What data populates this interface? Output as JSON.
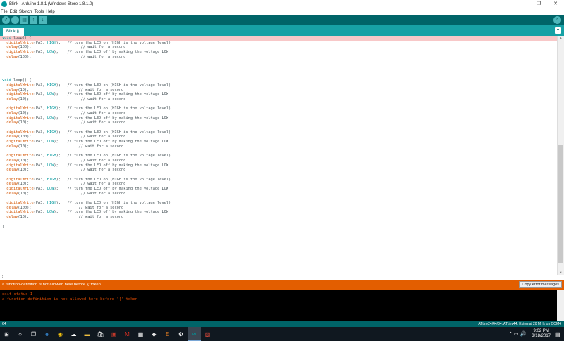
{
  "window": {
    "title": "Blink | Arduino 1.8.1 (Windows Store 1.8.1.0)",
    "controls": [
      "—",
      "❐",
      "✕"
    ]
  },
  "menu": [
    "File",
    "Edit",
    "Sketch",
    "Tools",
    "Help"
  ],
  "toolbar": {
    "verify_glyph": "✓",
    "upload_glyph": "→",
    "new_glyph": "▤",
    "open_glyph": "↑",
    "save_glyph": "↓",
    "serial_glyph": "⌕"
  },
  "tab": {
    "label": "Blink §",
    "menu_glyph": "▾"
  },
  "code": {
    "loop_a": {
      "header": "void loop() {",
      "lines": [
        {
          "fn": "digitalWrite",
          "args": "(PA3, ",
          "const": "HIGH",
          "tail": ");   // turn the LED on (HIGH is the voltage level)"
        },
        {
          "fn": "delay",
          "args": "(100);",
          "const": "",
          "tail": "                      // wait for a second"
        },
        {
          "fn": "digitalWrite",
          "args": "(PA3, ",
          "const": "LOW",
          "tail": ");    // turn the LED off by making the voltage LOW"
        },
        {
          "fn": "delay",
          "args": "(100);",
          "const": "",
          "tail": "                      // wait for a second"
        }
      ]
    },
    "loop_b_header": "void loop() {",
    "blocks": [
      [
        {
          "fn": "digitalWrite",
          "args": "(PA3, ",
          "const": "HIGH",
          "tail": ");   // turn the LED on (HIGH is the voltage level)"
        },
        {
          "fn": "delay",
          "args": "(10);",
          "const": "",
          "tail": "                      // wait for a second"
        },
        {
          "fn": "digitalWrite",
          "args": "(PA3, ",
          "const": "LOW",
          "tail": ");    // turn the LED off by making the voltage LOW"
        },
        {
          "fn": "delay",
          "args": "(10);",
          "const": "",
          "tail": "                       // wait for a second"
        }
      ],
      [
        {
          "fn": "digitalWrite",
          "args": "(PA3, ",
          "const": "HIGH",
          "tail": ");   // turn the LED on (HIGH is the voltage level)"
        },
        {
          "fn": "delay",
          "args": "(10);",
          "const": "",
          "tail": "                       // wait for a second"
        },
        {
          "fn": "digitalWrite",
          "args": "(PA3, ",
          "const": "LOW",
          "tail": ");    // turn the LED off by making the voltage LOW"
        },
        {
          "fn": "delay",
          "args": "(10);",
          "const": "",
          "tail": "                       // wait for a second"
        }
      ],
      [
        {
          "fn": "digitalWrite",
          "args": "(PA3, ",
          "const": "HIGH",
          "tail": ");   // turn the LED on (HIGH is the voltage level)"
        },
        {
          "fn": "delay",
          "args": "(100);",
          "const": "",
          "tail": "                      // wait for a second"
        },
        {
          "fn": "digitalWrite",
          "args": "(PA3, ",
          "const": "LOW",
          "tail": ");    // turn the LED off by making the voltage LOW"
        },
        {
          "fn": "delay",
          "args": "(10);",
          "const": "",
          "tail": "                      // wait for a second"
        }
      ],
      [
        {
          "fn": "digitalWrite",
          "args": "(PA3, ",
          "const": "HIGH",
          "tail": ");   // turn the LED on (HIGH is the voltage level)"
        },
        {
          "fn": "delay",
          "args": "(10);",
          "const": "",
          "tail": "                       // wait for a second"
        },
        {
          "fn": "digitalWrite",
          "args": "(PA3, ",
          "const": "LOW",
          "tail": ");    // turn the LED off by making the voltage LOW"
        },
        {
          "fn": "delay",
          "args": "(10);",
          "const": "",
          "tail": "                       // wait for a second"
        }
      ],
      [
        {
          "fn": "digitalWrite",
          "args": "(PA3, ",
          "const": "HIGH",
          "tail": ");   // turn the LED on (HIGH is the voltage level)"
        },
        {
          "fn": "delay",
          "args": "(10);",
          "const": "",
          "tail": "                       // wait for a second"
        },
        {
          "fn": "digitalWrite",
          "args": "(PA3, ",
          "const": "LOW",
          "tail": ");    // turn the LED off by making the voltage LOW"
        },
        {
          "fn": "delay",
          "args": "(10);",
          "const": "",
          "tail": "                       // wait for a second"
        }
      ],
      [
        {
          "fn": "digitalWrite",
          "args": "(PA3, ",
          "const": "HIGH",
          "tail": ");   // turn the LED on (HIGH is the voltage level)"
        },
        {
          "fn": "delay",
          "args": "(100);",
          "const": "",
          "tail": "                     // wait for a second"
        },
        {
          "fn": "digitalWrite",
          "args": "(PA3, ",
          "const": "LOW",
          "tail": ");    // turn the LED off by making the voltage LOW"
        },
        {
          "fn": "delay",
          "args": "(10);",
          "const": "",
          "tail": "                      // wait for a second"
        }
      ]
    ],
    "closing": "}"
  },
  "message": {
    "text": "a function-definition is not allowed here before '{' token",
    "copy_label": "Copy error messages"
  },
  "console": [
    "exit status 1",
    "a function-definition is not allowed here before '{' token"
  ],
  "status": {
    "line": "64",
    "board": "ATtiny24/44/84, ATtiny44, External 20 MHz on COM4"
  },
  "taskbar": {
    "items": [
      {
        "name": "windows-start-icon",
        "glyph": "⊞",
        "color": "#ffffff"
      },
      {
        "name": "search-icon",
        "glyph": "○",
        "color": "#ffffff"
      },
      {
        "name": "task-view-icon",
        "glyph": "❐",
        "color": "#ffffff"
      },
      {
        "name": "edge-icon",
        "glyph": "e",
        "color": "#3c9bf0"
      },
      {
        "name": "chrome-icon",
        "glyph": "◉",
        "color": "#f4c20d"
      },
      {
        "name": "onedrive-icon",
        "glyph": "☁",
        "color": "#ffffff"
      },
      {
        "name": "file-explorer-icon",
        "glyph": "▬",
        "color": "#f0c040"
      },
      {
        "name": "store-icon",
        "glyph": "🛍",
        "color": "#ffffff"
      },
      {
        "name": "photo-app-icon",
        "glyph": "▣",
        "color": "#c0392b"
      },
      {
        "name": "red-m-icon",
        "glyph": "M",
        "color": "#d62d20"
      },
      {
        "name": "calculator-icon",
        "glyph": "▦",
        "color": "#ffffff"
      },
      {
        "name": "inkscape-icon",
        "glyph": "◆",
        "color": "#e6e6e6"
      },
      {
        "name": "orange-e-icon",
        "glyph": "E",
        "color": "#e67e22"
      },
      {
        "name": "settings-icon",
        "glyph": "⚙",
        "color": "#ffffff"
      },
      {
        "name": "arduino-icon",
        "glyph": "∞",
        "color": "#00979c"
      },
      {
        "name": "paint-icon",
        "glyph": "▧",
        "color": "#e74c3c"
      }
    ],
    "tray_glyphs": "⌃ ▭ 🔊",
    "time": "9:02 PM",
    "date": "3/18/2017",
    "notification_glyph": "▤"
  }
}
